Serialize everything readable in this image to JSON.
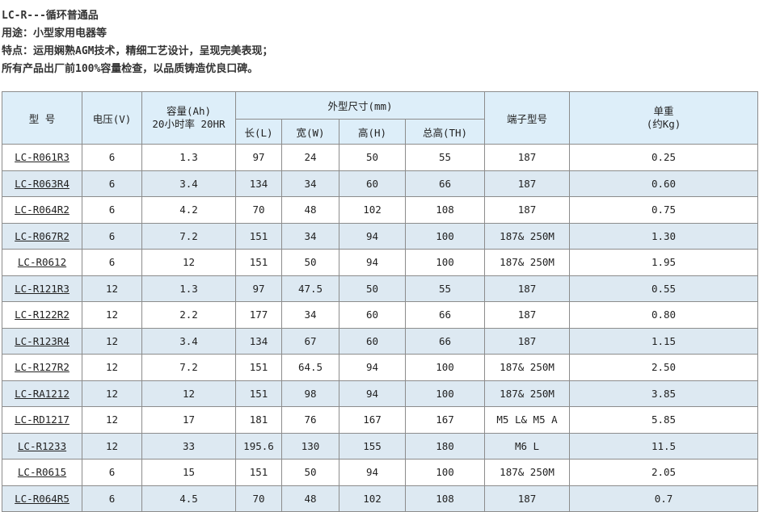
{
  "intro": [
    "LC-R---循环普通品",
    "用途：小型家用电器等",
    "特点：运用娴熟AGM技术，精细工艺设计，呈现完美表现；",
    "所有产品出厂前100%容量检查，以品质铸造优良口碑。"
  ],
  "headers": {
    "model": "型 号",
    "voltage": "电压(V)",
    "capacity_l1": "容量(Ah)",
    "capacity_l2": "20小时率 20HR",
    "dims": "外型尺寸(mm)",
    "length": "长(L)",
    "width": "宽(W)",
    "height": "高(H)",
    "total_height": "总高(TH)",
    "terminal": "端子型号",
    "weight_l1": "单重",
    "weight_l2": "(约Kg)"
  },
  "rows": [
    [
      "LC-R061R3",
      "6",
      "1.3",
      "97",
      "24",
      "50",
      "55",
      "187",
      "0.25"
    ],
    [
      "LC-R063R4",
      "6",
      "3.4",
      "134",
      "34",
      "60",
      "66",
      "187",
      "0.60"
    ],
    [
      "LC-R064R2",
      "6",
      "4.2",
      "70",
      "48",
      "102",
      "108",
      "187",
      "0.75"
    ],
    [
      "LC-R067R2",
      "6",
      "7.2",
      "151",
      "34",
      "94",
      "100",
      "187& 250M",
      "1.30"
    ],
    [
      "LC-R0612",
      "6",
      "12",
      "151",
      "50",
      "94",
      "100",
      "187& 250M",
      "1.95"
    ],
    [
      "LC-R121R3",
      "12",
      "1.3",
      "97",
      "47.5",
      "50",
      "55",
      "187",
      "0.55"
    ],
    [
      "LC-R122R2",
      "12",
      "2.2",
      "177",
      "34",
      "60",
      "66",
      "187",
      "0.80"
    ],
    [
      "LC-R123R4",
      "12",
      "3.4",
      "134",
      "67",
      "60",
      "66",
      "187",
      "1.15"
    ],
    [
      "LC-R127R2",
      "12",
      "7.2",
      "151",
      "64.5",
      "94",
      "100",
      "187& 250M",
      "2.50"
    ],
    [
      "LC-RA1212",
      "12",
      "12",
      "151",
      "98",
      "94",
      "100",
      "187& 250M",
      "3.85"
    ],
    [
      "LC-RD1217",
      "12",
      "17",
      "181",
      "76",
      "167",
      "167",
      "M5 L& M5 A",
      "5.85"
    ],
    [
      "LC-R1233",
      "12",
      "33",
      "195.6",
      "130",
      "155",
      "180",
      "M6 L",
      "11.5"
    ],
    [
      "LC-R0615",
      "6",
      "15",
      "151",
      "50",
      "94",
      "100",
      "187& 250M",
      "2.05"
    ],
    [
      "LC-R064R5",
      "6",
      "4.5",
      "70",
      "48",
      "102",
      "108",
      "187",
      "0.7"
    ]
  ]
}
